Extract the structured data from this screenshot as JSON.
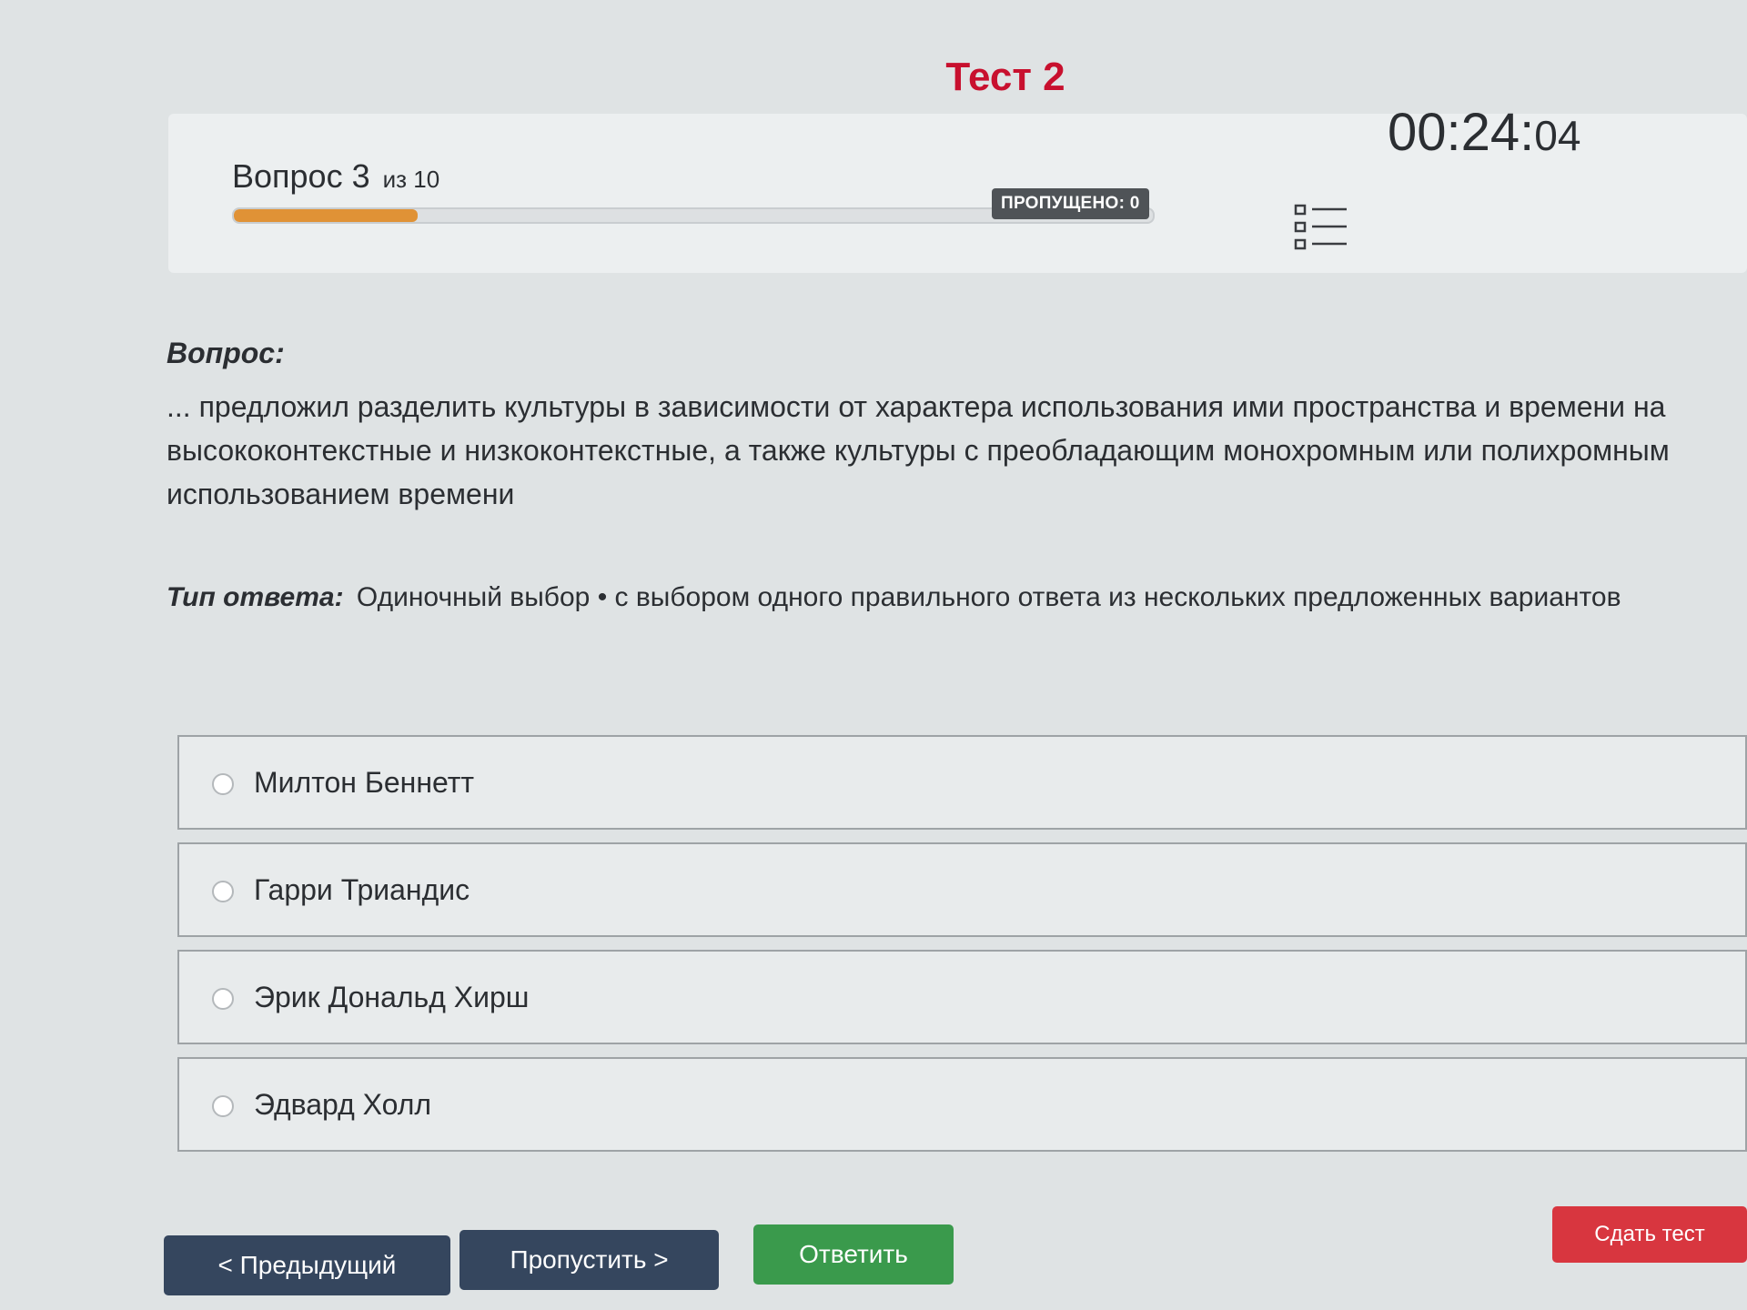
{
  "page": {
    "title": "Тест 2"
  },
  "header": {
    "question_prefix": "Вопрос 3",
    "question_of": "из 10",
    "progress_fraction": 0.2,
    "skipped_badge": "ПРОПУЩЕНО: 0",
    "list_icon": "question-list-icon",
    "timer_main": "00:24:",
    "timer_seconds": "04"
  },
  "question": {
    "label": "Вопрос:",
    "text": "... предложил разделить культуры в зависимости от характера использования ими пространства и времени на высококонтекстные и низкоконтекстные, а также культуры с преобладающим монохромным или полихромным использованием времени"
  },
  "answer_type": {
    "label": "Тип ответа:",
    "value": "Одиночный выбор • с выбором одного правильного ответа из нескольких предложенных вариантов"
  },
  "options": [
    {
      "label": "Милтон Беннетт"
    },
    {
      "label": "Гарри Триандис"
    },
    {
      "label": "Эрик Дональд Хирш"
    },
    {
      "label": "Эдвард Холл"
    }
  ],
  "buttons": {
    "prev": "< Предыдущий",
    "skip": "Пропустить >",
    "answer": "Ответить",
    "submit": "Сдать тест"
  },
  "colors": {
    "title": "#c8102e",
    "progress": "#e09236",
    "nav_button": "#35465e",
    "answer_button": "#3a9a4c",
    "submit_button": "#d8363f"
  }
}
